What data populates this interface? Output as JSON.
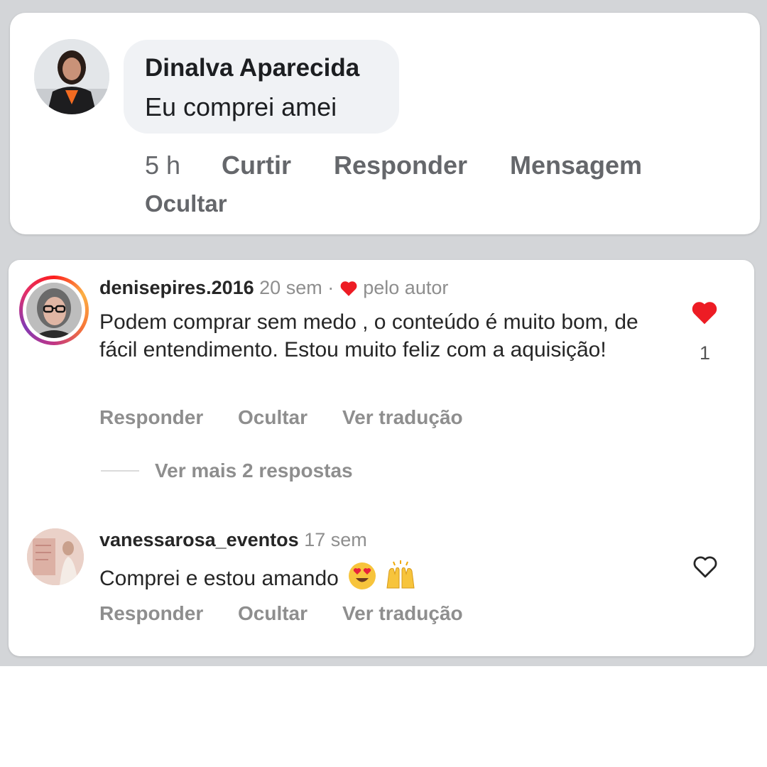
{
  "facebook_comment": {
    "author": "Dinalva Aparecida",
    "text": "Eu comprei amei",
    "time": "5 h",
    "actions": {
      "like": "Curtir",
      "reply": "Responder",
      "message": "Mensagem",
      "hide": "Ocultar"
    }
  },
  "instagram_comments": [
    {
      "username": "denisepires.2016",
      "time": "20 sem",
      "separator": "·",
      "liked_by_author": "pelo autor",
      "text": "Podem comprar sem medo , o conteúdo é muito bom, de fácil entendimento. Estou muito feliz com a aquisição!",
      "reply": "Responder",
      "hide": "Ocultar",
      "translate": "Ver tradução",
      "likes": "1",
      "liked": true,
      "view_replies": "Ver mais 2 respostas"
    },
    {
      "username": "vanessarosa_eventos",
      "time": "17 sem",
      "text": "Comprei e estou amando",
      "emojis": [
        "smiling-face-with-heart-eyes",
        "raising-hands"
      ],
      "reply": "Responder",
      "hide": "Ocultar",
      "translate": "Ver tradução",
      "liked": false
    }
  ],
  "colors": {
    "band": "#d3d5d8",
    "fb_bubble": "#f0f2f5",
    "fb_action": "#65676b",
    "ig_text": "#262626",
    "ig_muted": "#8e8e8e",
    "like_red": "#ed1c24"
  }
}
